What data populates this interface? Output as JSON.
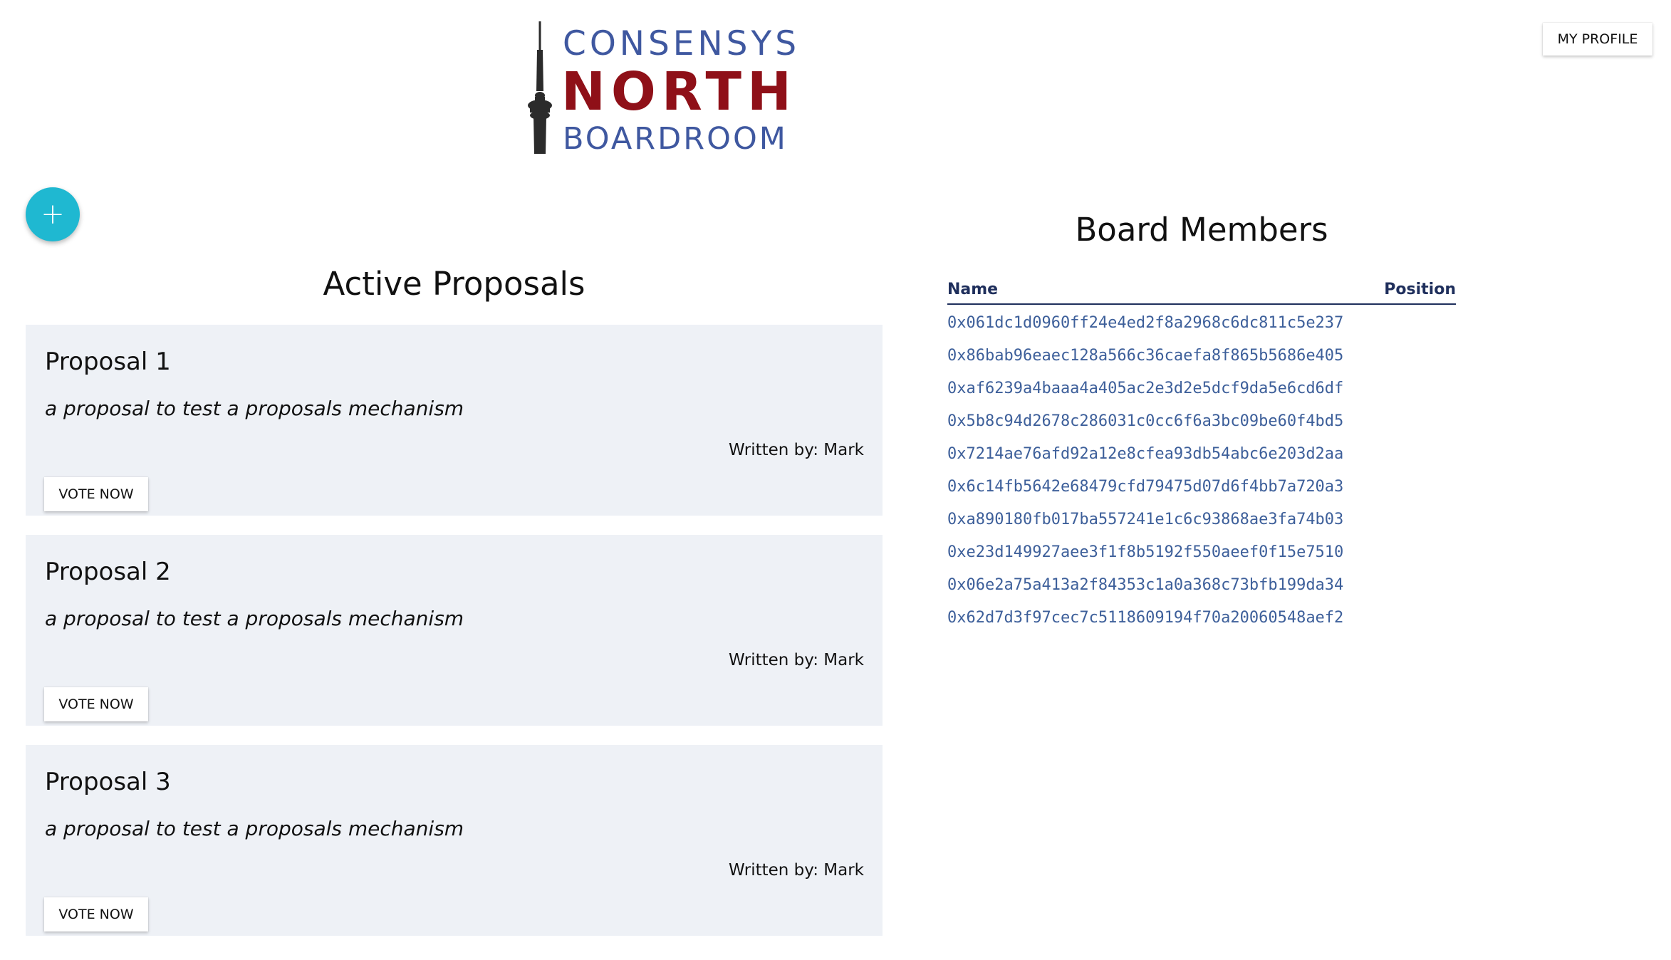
{
  "logo": {
    "line1": "CONSENSYS",
    "line2": "NORTH",
    "line3": "BOARDROOM",
    "colors": {
      "blue": "#3f58a0",
      "red": "#8f1018",
      "tower": "#2b2b2b"
    }
  },
  "header": {
    "profile_label": "MY PROFILE"
  },
  "fab": {
    "icon": "plus-icon",
    "symbol": "+",
    "color": "#1fb8d1"
  },
  "proposals": {
    "title": "Active Proposals",
    "items": [
      {
        "title": "Proposal 1",
        "description": "a proposal to test a proposals mechanism",
        "author": "Written by: Mark",
        "vote_label": "VOTE NOW"
      },
      {
        "title": "Proposal 2",
        "description": "a proposal to test a proposals mechanism",
        "author": "Written by: Mark",
        "vote_label": "VOTE NOW"
      },
      {
        "title": "Proposal 3",
        "description": "a proposal to test a proposals mechanism",
        "author": "Written by: Mark",
        "vote_label": "VOTE NOW"
      }
    ]
  },
  "board": {
    "title": "Board Members",
    "columns": {
      "name": "Name",
      "position": "Position"
    },
    "members": [
      "0x061dc1d0960ff24e4ed2f8a2968c6dc811c5e237",
      "0x86bab96eaec128a566c36caefa8f865b5686e405",
      "0xaf6239a4baaa4a405ac2e3d2e5dcf9da5e6cd6df",
      "0x5b8c94d2678c286031c0cc6f6a3bc09be60f4bd5",
      "0x7214ae76afd92a12e8cfea93db54abc6e203d2aa",
      "0x6c14fb5642e68479cfd79475d07d6f4bb7a720a3",
      "0xa890180fb017ba557241e1c6c93868ae3fa74b03",
      "0xe23d149927aee3f1f8b5192f550aeef0f15e7510",
      "0x06e2a75a413a2f84353c1a0a368c73bfb199da34",
      "0x62d7d3f97cec7c5118609194f70a20060548aef2"
    ]
  }
}
